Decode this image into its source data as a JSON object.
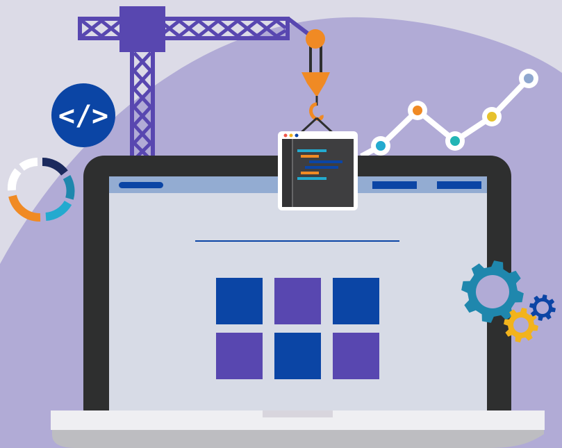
{
  "colors": {
    "background": "#dcdbe7",
    "hill": "#b1abd6",
    "laptop_bezel": "#2e2f2f",
    "screen": "#d7dbe6",
    "topbar": "#93acd2",
    "navy": "#0b45a5",
    "purple": "#5847b0",
    "orange": "#f08a24",
    "teal": "#1f87ad",
    "yellow": "#f2b31c",
    "cyan": "#23aacf",
    "base_light": "#efeff2",
    "base_shadow": "#bdbdc1"
  },
  "icons": {
    "code_badge": "code-brackets-icon",
    "crane": "construction-crane-icon",
    "chart": "line-chart-icon",
    "gears": "gears-icon",
    "spinner": "loading-ring-icon"
  },
  "code_badge": {
    "text": "</>"
  },
  "chart_points": [
    {
      "color": "#23aacf"
    },
    {
      "color": "#f08a24"
    },
    {
      "color": "#23b5b5"
    },
    {
      "color": "#e6c12c"
    },
    {
      "color": "#8fa7cf"
    }
  ],
  "tiles": [
    {
      "color": "#0b45a5"
    },
    {
      "color": "#5847b0"
    },
    {
      "color": "#0b45a5"
    },
    {
      "color": "#5847b0"
    },
    {
      "color": "#0b45a5"
    },
    {
      "color": "#5847b0"
    }
  ]
}
